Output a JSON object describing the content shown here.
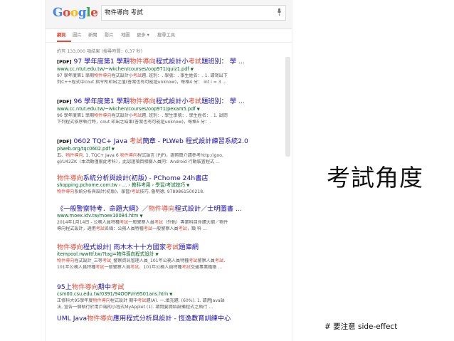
{
  "google": {
    "logo_letters": [
      {
        "ch": "G",
        "color": "#4285f4"
      },
      {
        "ch": "o",
        "color": "#ea4335"
      },
      {
        "ch": "o",
        "color": "#fbbc05"
      },
      {
        "ch": "g",
        "color": "#4285f4"
      },
      {
        "ch": "l",
        "color": "#34a853"
      },
      {
        "ch": "e",
        "color": "#ea4335"
      }
    ],
    "search_value": "物件導向 考試",
    "mic_icon": "microphone-icon"
  },
  "tabs": [
    {
      "label": "網頁",
      "active": true
    },
    {
      "label": "圖片",
      "active": false
    },
    {
      "label": "新聞",
      "active": false
    },
    {
      "label": "影片",
      "active": false
    },
    {
      "label": "地圖",
      "active": false
    },
    {
      "label": "更多 ▾",
      "active": false
    },
    {
      "label": "搜尋工具",
      "active": false
    }
  ],
  "stats": "約有 133,000 項結果 (搜尋時間：0.37 秒)",
  "results": [
    {
      "tag": "[PDF]",
      "title": "97 學年度第1 學期物件導向程式設計小考試題班別： 學 ...",
      "url": "www.cc.ntut.edu.tw/~wkchen/courses/oop971/quiz1.pdf",
      "snippet": [
        "97 學年度第1 學期物件導向程式設計小考試題. 班別：. 學號：. 學生姓名：. 1. 請寫出下",
        "列C++程式中cout 指令所印出之值(答案也有可能是unknow)，每格4 分： int i = 3 ..."
      ]
    },
    {
      "tag": "[PDF]",
      "title": "96 學年度第1 學期物件導向程式設計小考試題班別： 學 ...",
      "url": "www.cc.ntut.edu.tw/~wkchen/courses/oop971/pexam5.pdf",
      "snippet": [
        "96 學年度第1 學期物件導向程式設計小考試題. 班別：. 學生學號：. 學生姓名：. 1. 試問",
        "下列程式依序執行時，cout 印出之結果(答案也有可能是unknow)，每格5 分：."
      ]
    },
    {
      "tag": "[PDF]",
      "title": "0602 TQC+ Java 考試簡章 - PLWeb 程式設計練習系統2.0",
      "url": "plweb.org/tqc0602.pdf",
      "snippet": [
        "五、物件導向. 1. TQC+ Java 6 物件導向程式語言 (PJP)，證照簡介請參考http://goo.",
        "gl/U42ZK（本活動僅限此考科），此認證項目相關人員同：Android 行動裝置程式 ..."
      ]
    },
    {
      "tag": "",
      "title": "物件導向系統分析與設計(初版) - PChome 24h書店",
      "url": "shopping.pchome.com.tw › ... › 教科考用 › 學習/考試技巧",
      "snippet": [
        "物件導向系統分析與設計(初版)，學習/考試技巧, 魯明德, 9789861500218."
      ]
    },
    {
      "tag": "",
      "title": "《一般警察特考．命題大綱》／物件導向程式設計／士明圖書 ...",
      "url": "www.moex.idv.tw/moex10084.htm",
      "snippet": [
        "2014年1月14日 - 公務人員特種考試一般警察人員考試（外軌）專業科目命題大綱／物件",
        "導向程式設計，適用考試名稱：公務人員特種考試一般警察人員考試，類 科 ..."
      ]
    },
    {
      "tag": "",
      "title": "物件導向程式設計| 雨木木十十方國家考試題庫網",
      "url": "itempool.rwwttf.tw/?tag=物件導向程式設計",
      "snippet": [
        "物件導向程式設計_三等考試_警察資訊管理人員_101年公務人員特種考試警察人員考試、",
        "101年公務人員特種考試一般警察人員考試、101年公務人員特種考試交通事業鐵路 ..."
      ]
    },
    {
      "tag": "",
      "title": "95上物件導向期中考試",
      "url": "csm00.csu.edu.tw/0391/94OOP/m9501ans.htm",
      "snippet": [
        "正修科大95學年度物件導向程式設計 期中考試題(A). 一.填充題: (60%). 1. 請用Java語",
        "法, 宣告一個執行於用戶端的小程式MyApplet (1). 請問要開始設備程式之執行 ..."
      ]
    },
    {
      "tag": "",
      "title": "UML Java物件導向應用程式分析與設計 - 恆逸教育訓練中心",
      "url": "",
      "snippet": []
    }
  ],
  "caption": {
    "main": "考試角度",
    "note": "# 要注意 side-effect"
  }
}
